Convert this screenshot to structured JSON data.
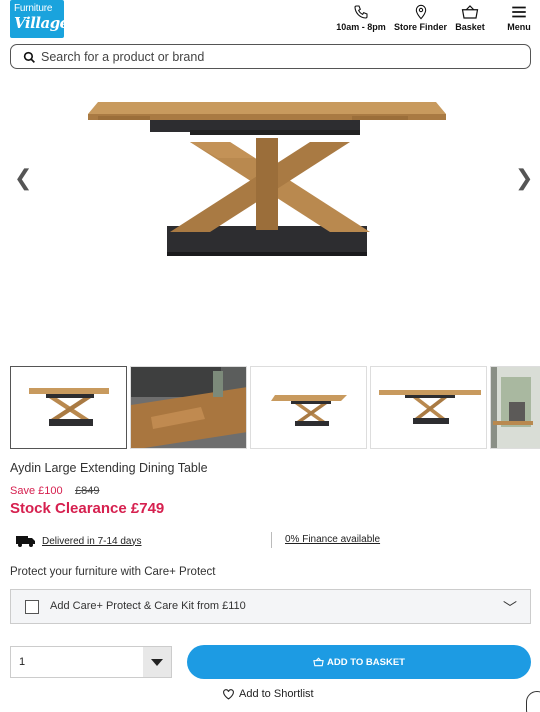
{
  "header": {
    "logo_line1": "Furniture",
    "logo_line2": "Village",
    "phone_label": "10am - 8pm",
    "store_label": "Store Finder",
    "basket_label": "Basket",
    "menu_label": "Menu"
  },
  "search": {
    "placeholder": "Search for a product or brand"
  },
  "gallery": {
    "prev_arrow": "❮",
    "next_arrow": "❯",
    "thumbnail_count": 5
  },
  "product": {
    "title": "Aydin Large Extending Dining Table",
    "save_text": "Save £100",
    "was_price": "£849",
    "now_price": "Stock Clearance £749"
  },
  "delivery": {
    "delivery_text": "Delivered in 7-14 days",
    "finance_text": "0% Finance available"
  },
  "care": {
    "heading": "Protect your furniture with Care+ Protect",
    "option_label": "Add Care+ Protect & Care Kit from £110",
    "chevron": "﹀"
  },
  "purchase": {
    "quantity": "1",
    "add_button": "ADD TO BASKET",
    "shortlist": "Add to Shortlist"
  },
  "colors": {
    "brand_blue": "#1aa3dd",
    "button_blue": "#1d9be3",
    "sale_red": "#d6204f",
    "oak": "#b9894f",
    "dark_base": "#2d2d30"
  }
}
